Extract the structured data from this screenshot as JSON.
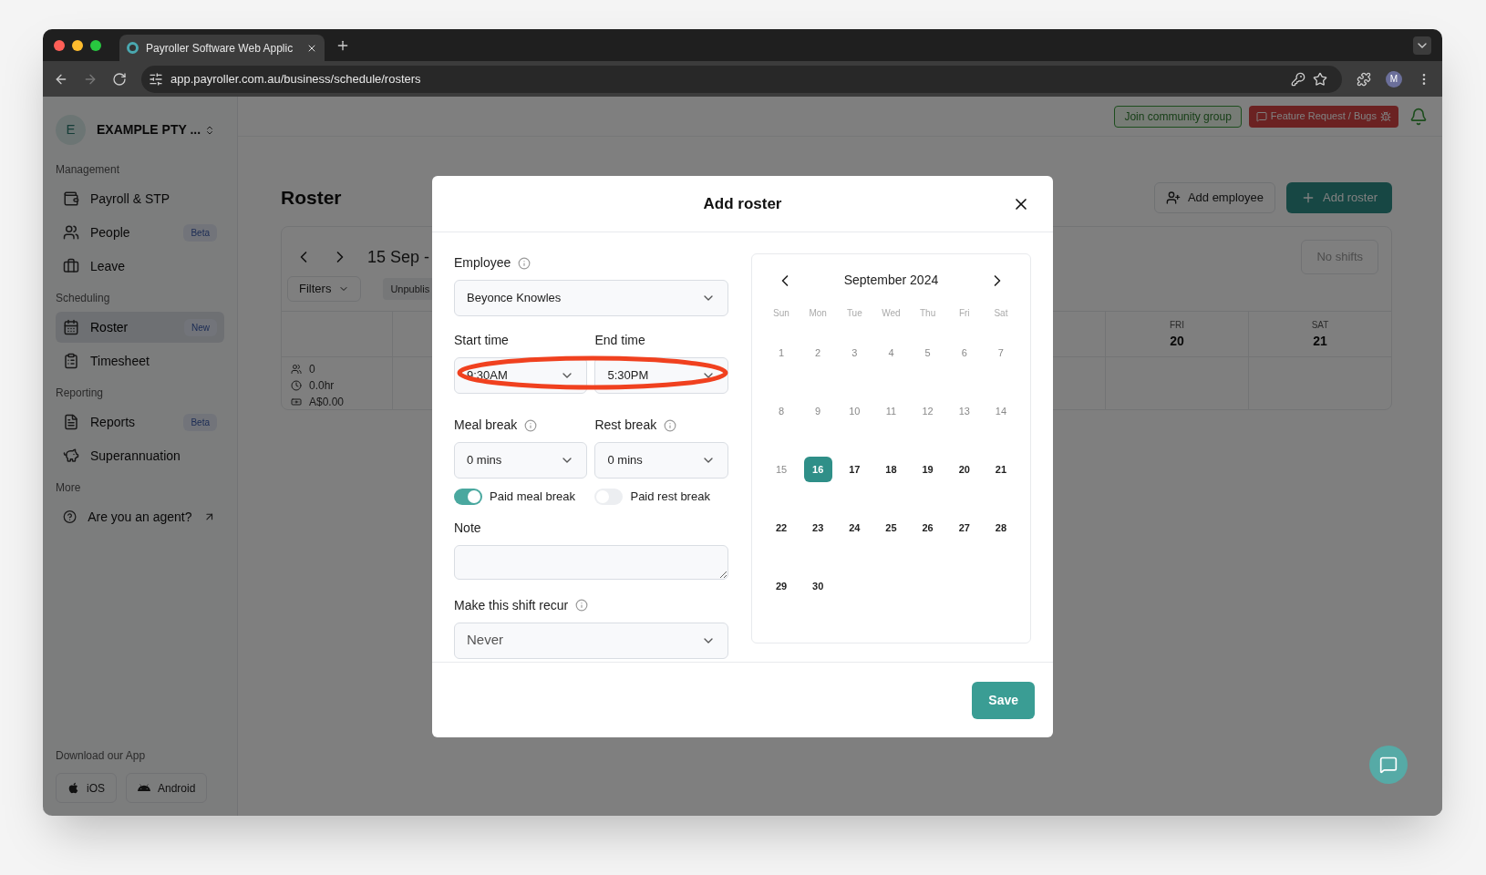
{
  "browser": {
    "tab_title": "Payroller Software Web Applic",
    "url": "app.payroller.com.au/business/schedule/rosters",
    "profile_initial": "M"
  },
  "sidebar": {
    "org_initial": "E",
    "org_name": "EXAMPLE PTY ...",
    "sections": [
      {
        "heading": "Management",
        "items": [
          {
            "label": "Payroll & STP",
            "selected": false
          },
          {
            "label": "People",
            "badge": "Beta",
            "selected": false
          },
          {
            "label": "Leave",
            "selected": false
          }
        ]
      },
      {
        "heading": "Scheduling",
        "items": [
          {
            "label": "Roster",
            "badge": "New",
            "selected": true
          },
          {
            "label": "Timesheet",
            "selected": false
          }
        ]
      },
      {
        "heading": "Reporting",
        "items": [
          {
            "label": "Reports",
            "badge": "Beta",
            "selected": false
          },
          {
            "label": "Superannuation",
            "selected": false
          }
        ]
      },
      {
        "heading": "More",
        "items": [
          {
            "label": "Are you an agent?",
            "selected": false
          }
        ]
      }
    ],
    "download": {
      "heading": "Download our App",
      "buttons": [
        "iOS",
        "Android"
      ]
    }
  },
  "topbar": {
    "community": "Join community group",
    "feature": "Feature Request / Bugs"
  },
  "page": {
    "title": "Roster",
    "add_employee": "Add employee",
    "add_roster": "Add roster",
    "range": "15 Sep -",
    "filters": "Filters",
    "unpublished": "Unpublis",
    "no_shifts": "No shifts",
    "days": [
      {
        "weekday": "FRI",
        "date": "20"
      },
      {
        "weekday": "SAT",
        "date": "21"
      }
    ],
    "summary": {
      "staff": "0",
      "hours": "0.0hr",
      "cost": "A$0.00"
    }
  },
  "modal": {
    "title": "Add roster",
    "employee": {
      "label": "Employee",
      "value": "Beyonce Knowles"
    },
    "start": {
      "label": "Start time",
      "value": "9:30AM"
    },
    "end": {
      "label": "End time",
      "value": "5:30PM"
    },
    "meal": {
      "label": "Meal break",
      "value": "0 mins"
    },
    "rest": {
      "label": "Rest break",
      "value": "0 mins"
    },
    "toggles": [
      {
        "label": "Paid meal break",
        "on": true
      },
      {
        "label": "Paid rest break",
        "on": false
      }
    ],
    "note": {
      "label": "Note"
    },
    "recur": {
      "label": "Make this shift recur",
      "value": "Never"
    },
    "save": "Save",
    "calendar": {
      "month": "September 2024",
      "weekdays": [
        "Sun",
        "Mon",
        "Tue",
        "Wed",
        "Thu",
        "Fri",
        "Sat"
      ],
      "days": [
        {
          "day": "1",
          "disabled": true,
          "selected": false
        },
        {
          "day": "2",
          "disabled": true,
          "selected": false
        },
        {
          "day": "3",
          "disabled": true,
          "selected": false
        },
        {
          "day": "4",
          "disabled": true,
          "selected": false
        },
        {
          "day": "5",
          "disabled": true,
          "selected": false
        },
        {
          "day": "6",
          "disabled": true,
          "selected": false
        },
        {
          "day": "7",
          "disabled": true,
          "selected": false
        },
        {
          "day": "8",
          "disabled": true,
          "selected": false
        },
        {
          "day": "9",
          "disabled": true,
          "selected": false
        },
        {
          "day": "10",
          "disabled": true,
          "selected": false
        },
        {
          "day": "11",
          "disabled": true,
          "selected": false
        },
        {
          "day": "12",
          "disabled": true,
          "selected": false
        },
        {
          "day": "13",
          "disabled": true,
          "selected": false
        },
        {
          "day": "14",
          "disabled": true,
          "selected": false
        },
        {
          "day": "15",
          "disabled": true,
          "selected": false
        },
        {
          "day": "16",
          "disabled": false,
          "selected": true
        },
        {
          "day": "17",
          "disabled": false,
          "selected": false
        },
        {
          "day": "18",
          "disabled": false,
          "selected": false
        },
        {
          "day": "19",
          "disabled": false,
          "selected": false
        },
        {
          "day": "20",
          "disabled": false,
          "selected": false
        },
        {
          "day": "21",
          "disabled": false,
          "selected": false
        },
        {
          "day": "22",
          "disabled": false,
          "selected": false
        },
        {
          "day": "23",
          "disabled": false,
          "selected": false
        },
        {
          "day": "24",
          "disabled": false,
          "selected": false
        },
        {
          "day": "25",
          "disabled": false,
          "selected": false
        },
        {
          "day": "26",
          "disabled": false,
          "selected": false
        },
        {
          "day": "27",
          "disabled": false,
          "selected": false
        },
        {
          "day": "28",
          "disabled": false,
          "selected": false
        },
        {
          "day": "29",
          "disabled": false,
          "selected": false
        },
        {
          "day": "30",
          "disabled": false,
          "selected": false
        }
      ]
    }
  }
}
